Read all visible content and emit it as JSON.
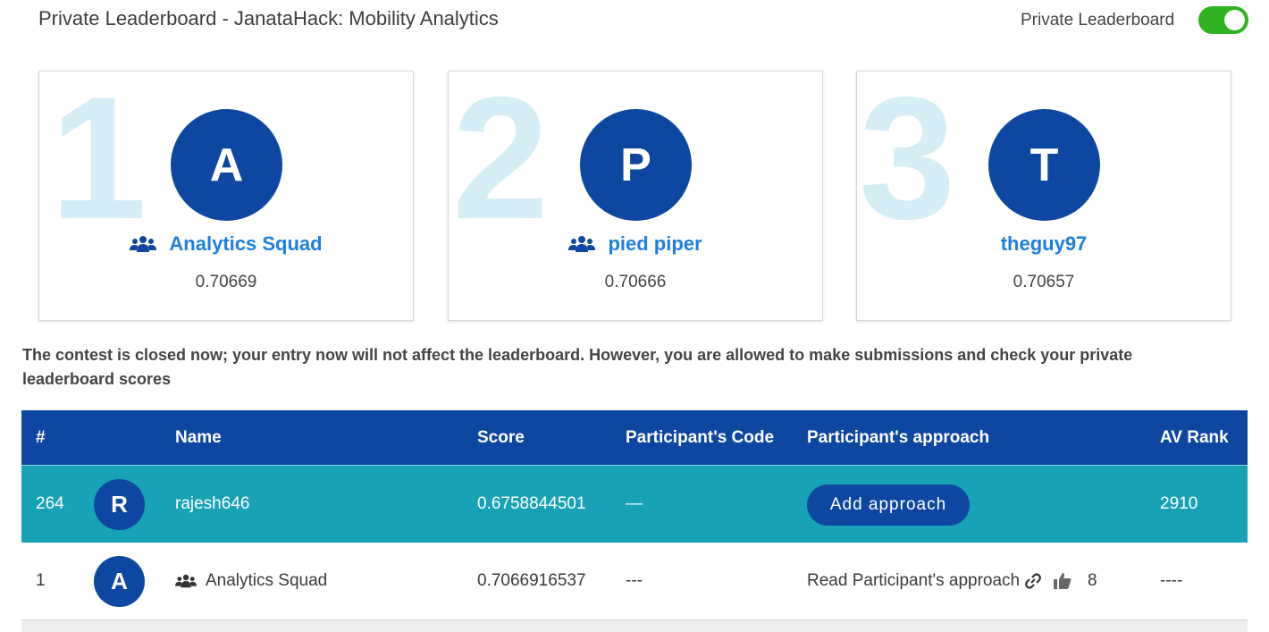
{
  "header": {
    "title": "Private Leaderboard - JanataHack: Mobility Analytics",
    "toggle_label": "Private Leaderboard",
    "toggle_on": true
  },
  "podium": [
    {
      "rank": "1",
      "initial": "A",
      "name": "Analytics Squad",
      "score": "0.70669",
      "is_team": true
    },
    {
      "rank": "2",
      "initial": "P",
      "name": "pied piper",
      "score": "0.70666",
      "is_team": true
    },
    {
      "rank": "3",
      "initial": "T",
      "name": "theguy97",
      "score": "0.70657",
      "is_team": false
    }
  ],
  "notice": "The contest is closed now; your entry now will not affect the leaderboard. However, you are allowed to make submissions and check your private leaderboard scores",
  "table": {
    "headers": {
      "rank": "#",
      "name": "Name",
      "score": "Score",
      "code": "Participant's Code",
      "approach": "Participant's approach",
      "av_rank": "AV Rank"
    },
    "my_row": {
      "rank": "264",
      "initial": "R",
      "name": "rajesh646",
      "score": "0.6758844501",
      "code": "—",
      "approach_button": "Add approach",
      "av_rank": "2910"
    },
    "rows": [
      {
        "rank": "1",
        "initial": "A",
        "name": "Analytics Squad",
        "score": "0.7066916537",
        "code": "---",
        "approach_link": "Read Participant's approach",
        "likes": "8",
        "av_rank": "----"
      }
    ]
  },
  "colors": {
    "brand_blue": "#0e47a1",
    "highlight_row": "#18a2b6",
    "link_blue": "#1d7fe0",
    "toggle_green": "#2fb41f",
    "rank_watermark": "#d6eef6"
  }
}
